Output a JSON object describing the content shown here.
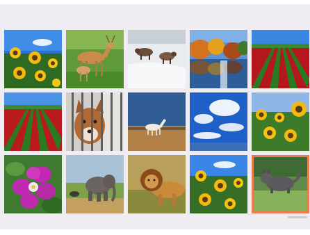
{
  "gallery": {
    "tiles": [
      {
        "subject": "sunflowers",
        "selected": false
      },
      {
        "subject": "deer",
        "selected": false
      },
      {
        "subject": "wolves-in-snow",
        "selected": false
      },
      {
        "subject": "autumn-lake",
        "selected": false
      },
      {
        "subject": "tulip-field",
        "selected": false
      },
      {
        "subject": "tulip-field",
        "selected": false
      },
      {
        "subject": "wolf-behind-bars",
        "selected": false
      },
      {
        "subject": "white-horse",
        "selected": false
      },
      {
        "subject": "blue-sky-clouds",
        "selected": false
      },
      {
        "subject": "sunflowers",
        "selected": false
      },
      {
        "subject": "pink-flower",
        "selected": false
      },
      {
        "subject": "elephant",
        "selected": false
      },
      {
        "subject": "lion",
        "selected": false
      },
      {
        "subject": "sunflowers",
        "selected": false
      },
      {
        "subject": "cat-on-grass",
        "selected": true
      }
    ],
    "accent_color": "#ee7a52"
  }
}
